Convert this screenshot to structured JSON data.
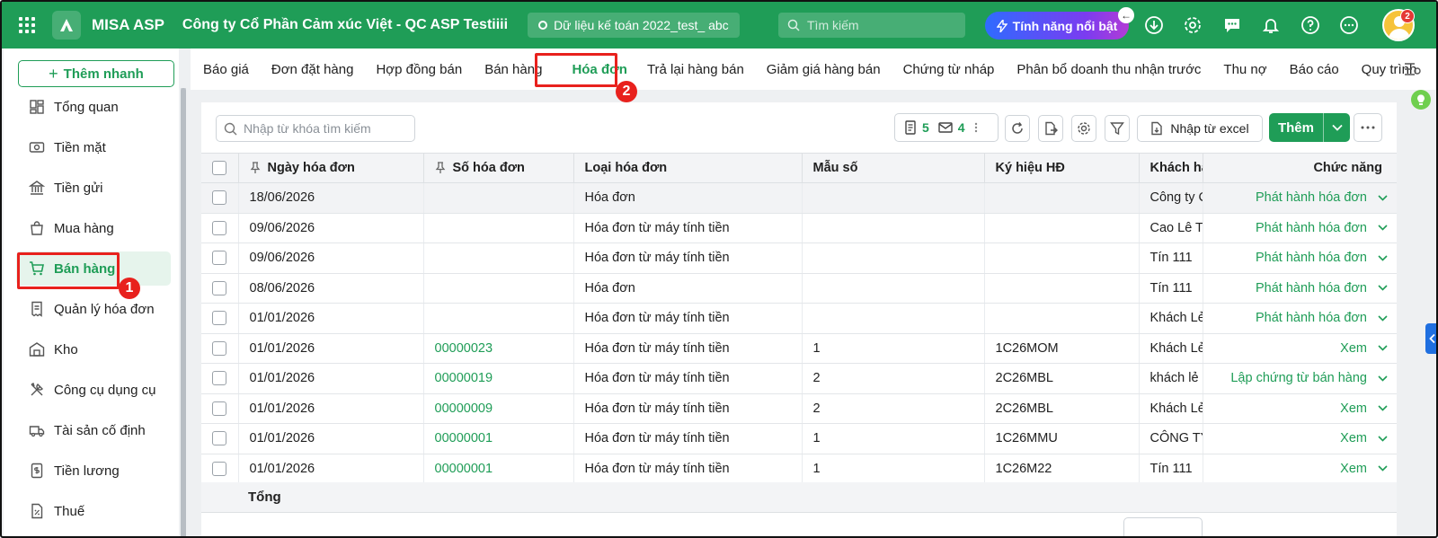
{
  "header": {
    "brand": "MISA ASP",
    "company": "Công ty Cổ Phần Cảm xúc Việt - QC ASP Testiiii",
    "database": "Dữ liệu kế toán 2022_test_ abc",
    "search_placeholder": "Tìm kiếm",
    "feature_button": "Tính năng nổi bật",
    "notification_count": "2",
    "icons": [
      "apps-grid-icon",
      "download-icon",
      "settings-icon",
      "chat-icon",
      "bell-icon",
      "help-icon",
      "more-icon"
    ],
    "accent_color": "#1f9d57"
  },
  "sidebar": {
    "quick_add": "Thêm nhanh",
    "items": [
      {
        "label": "Tổng quan",
        "icon": "dashboard-icon"
      },
      {
        "label": "Tiền mặt",
        "icon": "cash-icon"
      },
      {
        "label": "Tiền gửi",
        "icon": "bank-icon"
      },
      {
        "label": "Mua hàng",
        "icon": "shopping-bag-icon"
      },
      {
        "label": "Bán hàng",
        "icon": "cart-icon",
        "active": true
      },
      {
        "label": "Quản lý hóa đơn",
        "icon": "receipt-icon"
      },
      {
        "label": "Kho",
        "icon": "warehouse-icon"
      },
      {
        "label": "Công cụ dụng cụ",
        "icon": "tools-icon"
      },
      {
        "label": "Tài sản cố định",
        "icon": "truck-icon"
      },
      {
        "label": "Tiền lương",
        "icon": "salary-icon"
      },
      {
        "label": "Thuế",
        "icon": "tax-icon"
      }
    ]
  },
  "tabs": [
    {
      "label": "Báo giá"
    },
    {
      "label": "Đơn đặt hàng"
    },
    {
      "label": "Hợp đồng bán"
    },
    {
      "label": "Bán hàng"
    },
    {
      "label": "Hóa đơn",
      "active": true
    },
    {
      "label": "Trả lại hàng bán"
    },
    {
      "label": "Giảm giá hàng bán"
    },
    {
      "label": "Chứng từ nháp"
    },
    {
      "label": "Phân bổ doanh thu nhận trước"
    },
    {
      "label": "Thu nợ"
    },
    {
      "label": "Báo cáo"
    },
    {
      "label": "Quy trình"
    }
  ],
  "annotations": {
    "step1": "1",
    "step2": "2"
  },
  "toolbar": {
    "search_placeholder": "Nhập từ khóa tìm kiếm",
    "doc_count": "5",
    "mail_count": "4",
    "import_label": "Nhập từ excel",
    "add_label": "Thêm"
  },
  "table": {
    "columns": [
      "Ngày hóa đơn",
      "Số hóa đơn",
      "Loại hóa đơn",
      "Mẫu số",
      "Ký hiệu HĐ",
      "Khách hàng",
      "Chức năng"
    ],
    "rows": [
      {
        "date": "18/06/2026",
        "number": "",
        "type": "Hóa đơn",
        "form": "",
        "symbol": "",
        "customer": "Công ty C",
        "action": "Phát hành hóa đơn"
      },
      {
        "date": "09/06/2026",
        "number": "",
        "type": "Hóa đơn từ máy tính tiền",
        "form": "",
        "symbol": "",
        "customer": "Cao Lê Tr",
        "action": "Phát hành hóa đơn"
      },
      {
        "date": "09/06/2026",
        "number": "",
        "type": "Hóa đơn từ máy tính tiền",
        "form": "",
        "symbol": "",
        "customer": "Tín 111",
        "action": "Phát hành hóa đơn"
      },
      {
        "date": "08/06/2026",
        "number": "",
        "type": "Hóa đơn",
        "form": "",
        "symbol": "",
        "customer": "Tín 111",
        "action": "Phát hành hóa đơn"
      },
      {
        "date": "01/01/2026",
        "number": "",
        "type": "Hóa đơn từ máy tính tiền",
        "form": "",
        "symbol": "",
        "customer": "Khách Lẻ",
        "action": "Phát hành hóa đơn"
      },
      {
        "date": "01/01/2026",
        "number": "00000023",
        "type": "Hóa đơn từ máy tính tiền",
        "form": "1",
        "symbol": "1C26MOM",
        "customer": "Khách Lẻ",
        "action": "Xem"
      },
      {
        "date": "01/01/2026",
        "number": "00000019",
        "type": "Hóa đơn từ máy tính tiền",
        "form": "2",
        "symbol": "2C26MBL",
        "customer": "khách lẻ",
        "action": "Lập chứng từ bán hàng"
      },
      {
        "date": "01/01/2026",
        "number": "00000009",
        "type": "Hóa đơn từ máy tính tiền",
        "form": "2",
        "symbol": "2C26MBL",
        "customer": "Khách Lẻ",
        "action": "Xem"
      },
      {
        "date": "01/01/2026",
        "number": "00000001",
        "type": "Hóa đơn từ máy tính tiền",
        "form": "1",
        "symbol": "1C26MMU",
        "customer": "CÔNG TY",
        "action": "Xem"
      },
      {
        "date": "01/01/2026",
        "number": "00000001",
        "type": "Hóa đơn từ máy tính tiền",
        "form": "1",
        "symbol": "1C26M22",
        "customer": "Tín 111",
        "action": "Xem"
      }
    ],
    "total_label": "Tổng"
  }
}
